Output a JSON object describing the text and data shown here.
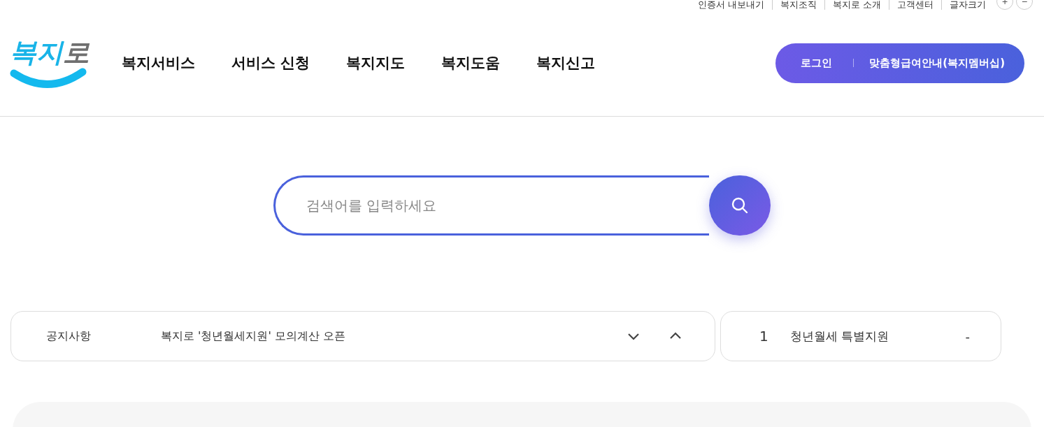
{
  "utility_links": [
    {
      "label": "인증서 내보내기"
    },
    {
      "label": "복지조직"
    },
    {
      "label": "복지로 소개"
    },
    {
      "label": "고객센터"
    },
    {
      "label": "글자크기"
    }
  ],
  "font_size_buttons": [
    "+",
    "−"
  ],
  "logo": {
    "parts": [
      "복지",
      "로"
    ]
  },
  "nav": [
    "복지서비스",
    "서비스 신청",
    "복지지도",
    "복지도움",
    "복지신고"
  ],
  "header_actions": [
    "로그인",
    "맞춤형급여안내(복지멤버십)"
  ],
  "search": {
    "placeholder": "검색어를 입력하세요"
  },
  "notice": {
    "label": "공지사항",
    "text": "복지로 '청년월세지원' 모의계산 오픈"
  },
  "popular": {
    "rank": "1",
    "text": "청년월세 특별지원",
    "change": "-"
  }
}
